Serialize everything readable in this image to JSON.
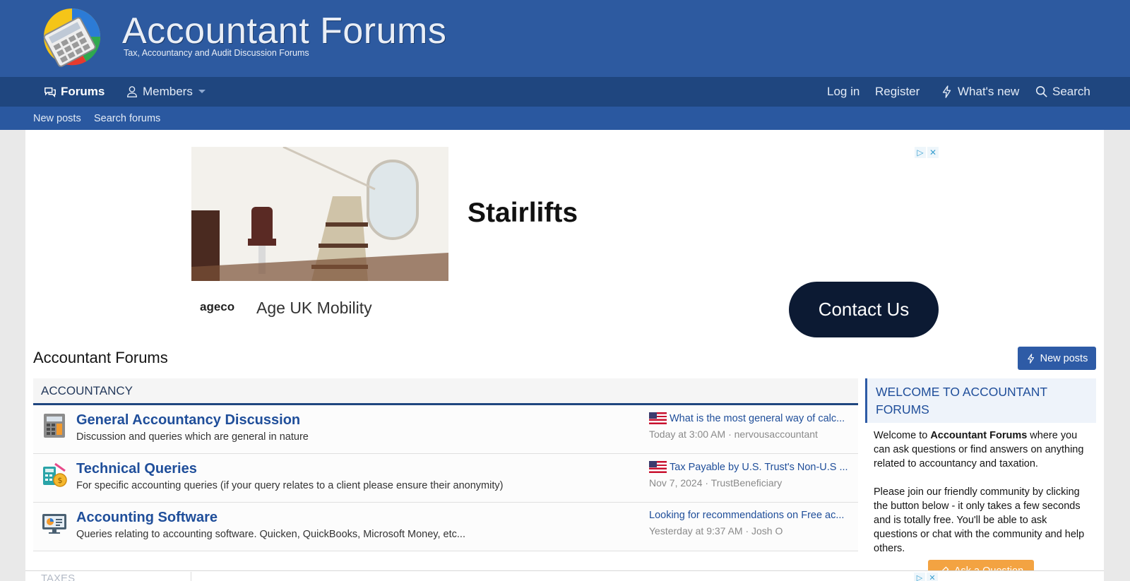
{
  "header": {
    "logo_title": "Accountant Forums",
    "logo_tagline": "Tax, Accountancy and Audit Discussion Forums"
  },
  "nav": {
    "left": [
      {
        "label": "Forums",
        "icon": "forums-chat-icon"
      },
      {
        "label": "Members",
        "icon": "user-icon"
      }
    ],
    "right": [
      {
        "label": "Log in"
      },
      {
        "label": "Register"
      },
      {
        "label": "What's new",
        "icon": "lightning-icon"
      },
      {
        "label": "Search",
        "icon": "search-icon"
      }
    ]
  },
  "subnav": {
    "items": [
      "New posts",
      "Search forums"
    ]
  },
  "ad": {
    "headline": "Stairlifts",
    "brand_logo": "ageco",
    "brand_name": "Age UK Mobility",
    "cta": "Contact Us"
  },
  "page": {
    "title": "Accountant Forums",
    "new_posts_button": "New posts"
  },
  "category": {
    "name": "ACCOUNTANCY",
    "forums": [
      {
        "title": "General Accountancy Discussion",
        "description": "Discussion and queries which are general in nature",
        "icon": "calculator-icon",
        "last_post_title": "What is the most general way of calc...",
        "last_post_meta": "Today at 3:00 AM · nervousaccountant",
        "flag": true
      },
      {
        "title": "Technical Queries",
        "description": "For specific accounting queries (if your query relates to a client please ensure their anonymity)",
        "icon": "coins-calculator-icon",
        "last_post_title": "Tax Payable by U.S. Trust's Non-U.S ...",
        "last_post_meta": "Nov 7, 2024 · TrustBeneficiary",
        "flag": true
      },
      {
        "title": "Accounting Software",
        "description": "Queries relating to accounting software. Quicken, QuickBooks, Microsoft Money, etc...",
        "icon": "monitor-chart-icon",
        "last_post_title": "Looking for recommendations on Free ac...",
        "last_post_meta": "Yesterday at 9:37 AM · Josh O",
        "flag": false
      }
    ]
  },
  "sidebar": {
    "title": "WELCOME TO ACCOUNTANT FORUMS",
    "intro_before": "Welcome to ",
    "intro_bold": "Accountant Forums",
    "intro_after": " where you can ask questions or find answers on anything related to accountancy and taxation.",
    "paragraph2": "Please join our friendly community by clicking the button below - it only takes a few seconds and is totally free. You'll be able to ask questions or chat with the community and help others.",
    "ask_button": "Ask a Question"
  },
  "next_category": "TAXES",
  "colors": {
    "header_bg": "#2d5aa0",
    "nav_bg": "#1f467f",
    "link": "#1f4e9a",
    "button": "#2e5ba6",
    "ask_button": "#f29a2e"
  }
}
